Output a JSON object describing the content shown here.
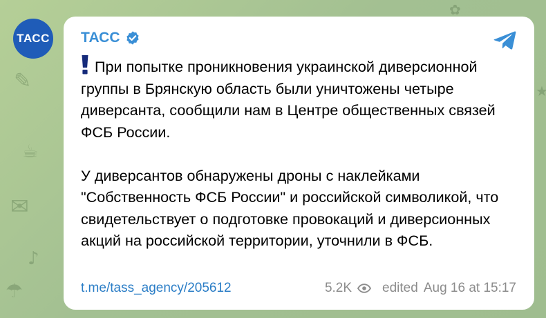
{
  "channel": {
    "avatar_text": "ТАСС",
    "name": "ТАСС"
  },
  "message": {
    "paragraphs": [
      "При попытке проникновения украинской диверсионной группы в Брянскую область были уничтожены четыре диверсанта, сообщили нам в Центре общественных связей ФСБ России.",
      "У диверсантов обнаружены дроны с наклейками \"Собственность ФСБ России\" и российской символикой, что свидетельствует о подготовке провокаций и диверсионных акций на российской территории, уточнили в ФСБ."
    ],
    "link": "t.me/tass_agency/205612",
    "views": "5.2K",
    "edited_label": "edited",
    "date": "Aug 16 at 15:17"
  },
  "icons": {
    "verified": "verified-badge-icon",
    "share": "telegram-share-icon",
    "views": "eye-icon",
    "emphasis": "exclamation-mark-icon"
  },
  "colors": {
    "wallpaper": "#a9c594",
    "avatar_bg": "#1f5cb8",
    "channel_name": "#3a8fd6",
    "link": "#2a7dc6",
    "meta": "#8c8c8c",
    "exclamation": "#152a7a"
  }
}
